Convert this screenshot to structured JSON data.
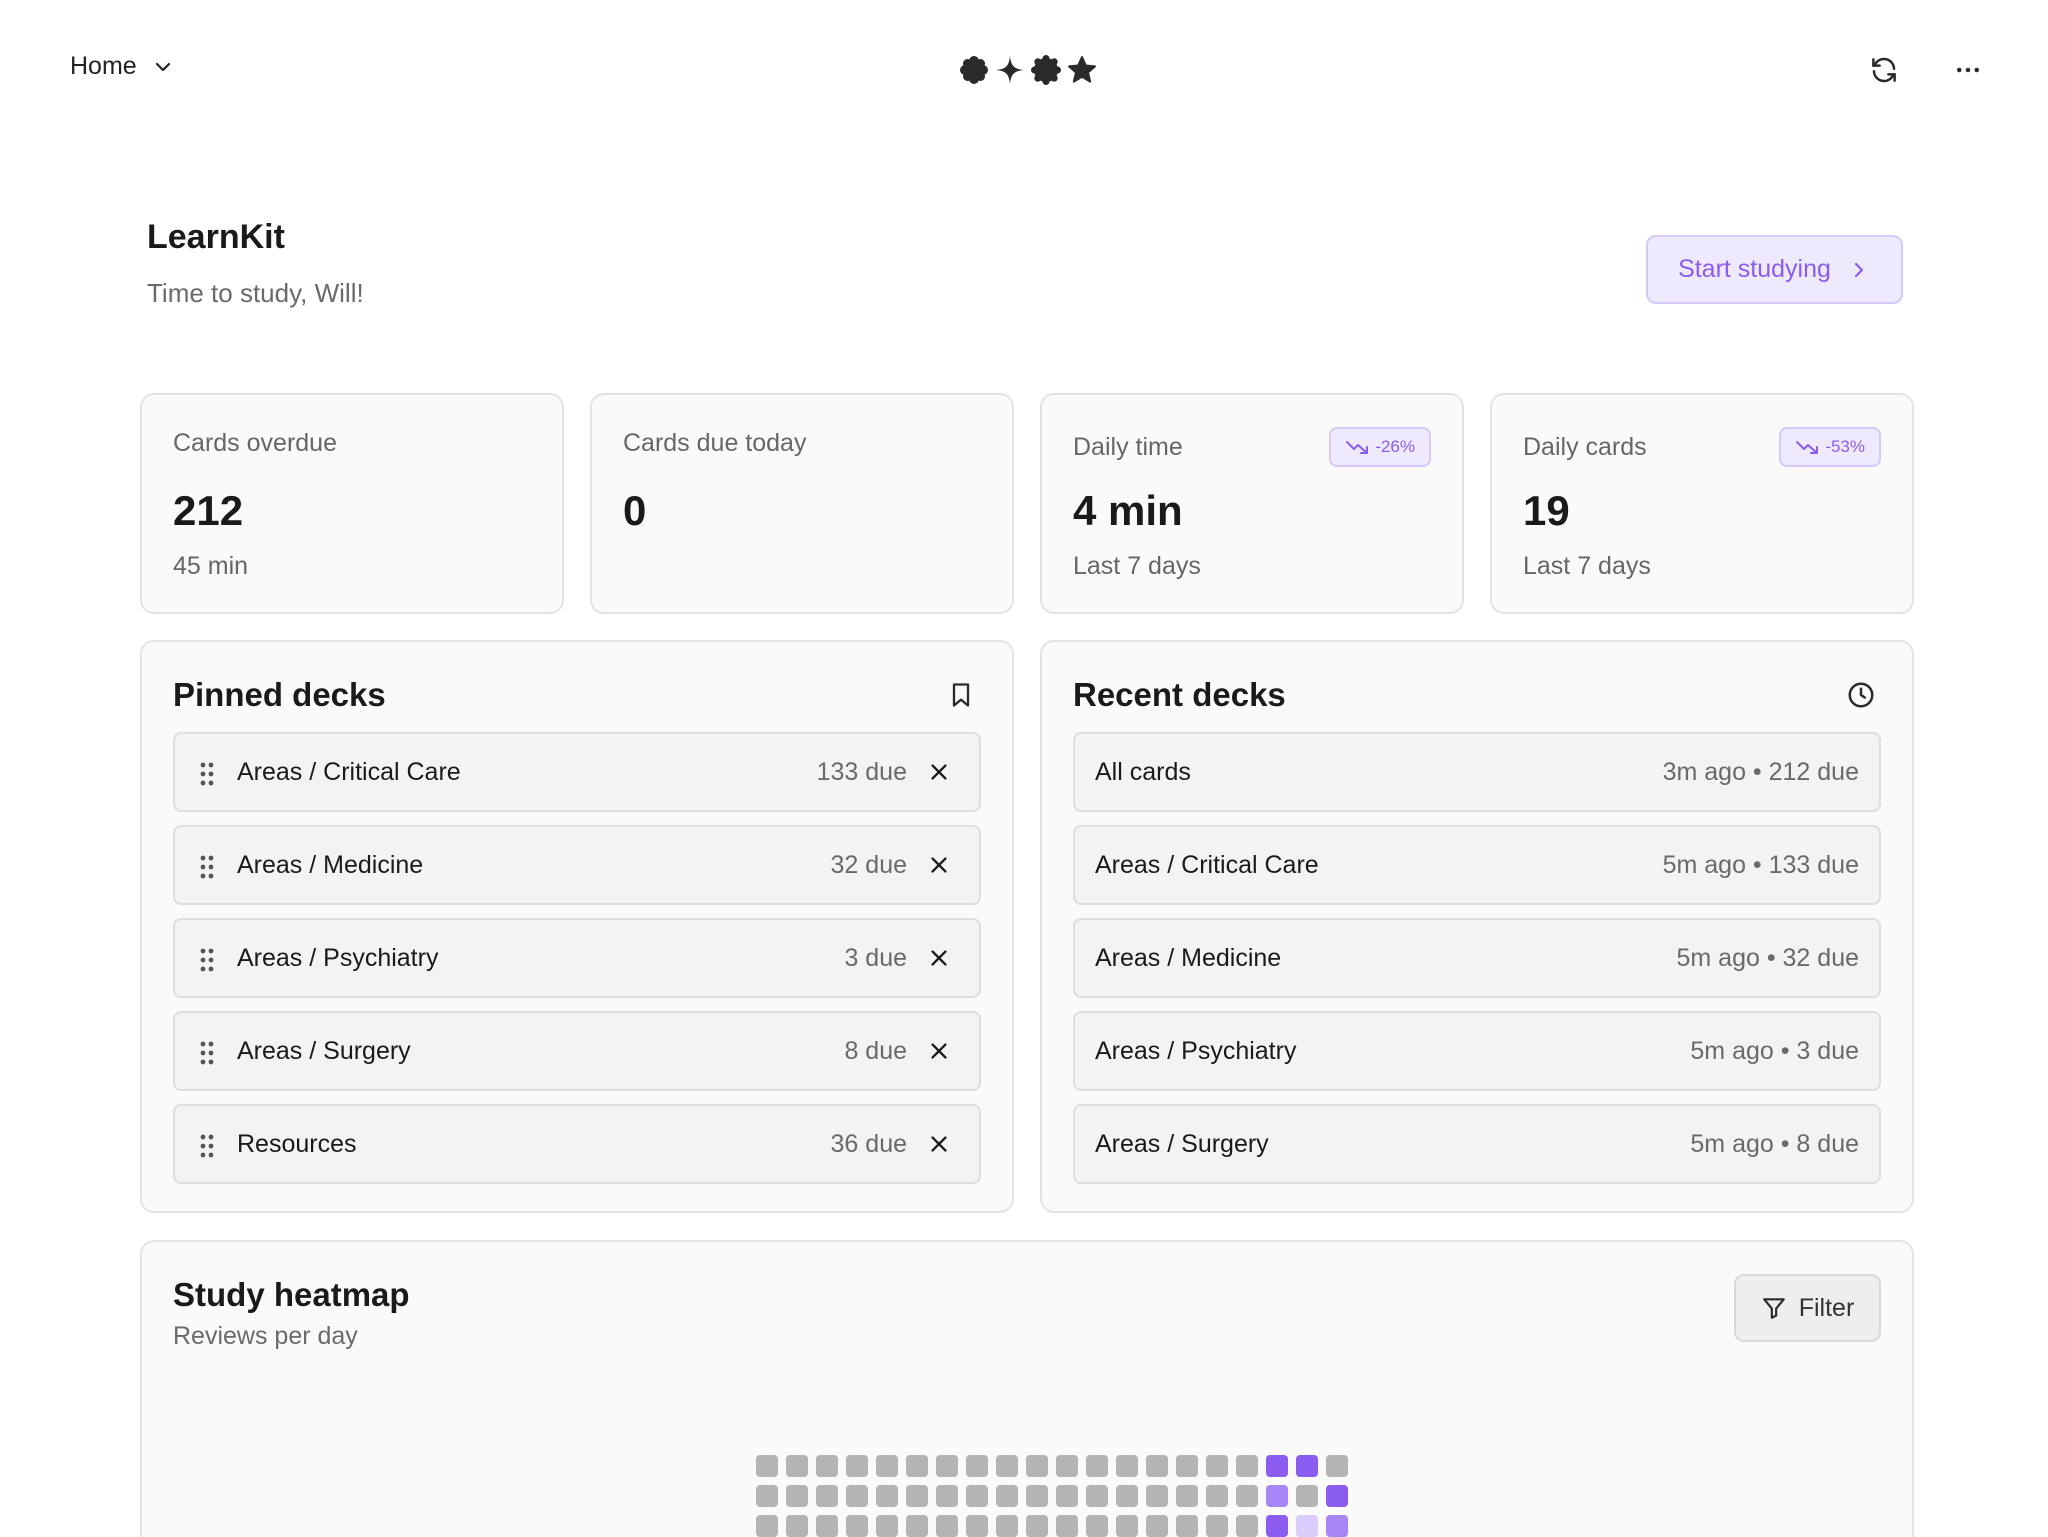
{
  "topbar": {
    "home_label": "Home"
  },
  "header": {
    "title": "LearnKit",
    "subtitle": "Time to study, Will!",
    "start_label": "Start studying"
  },
  "stats": [
    {
      "label": "Cards overdue",
      "value": "212",
      "sub": "45 min"
    },
    {
      "label": "Cards due today",
      "value": "0",
      "sub": ""
    },
    {
      "label": "Daily time",
      "value": "4 min",
      "sub": "Last 7 days",
      "trend": "-26%"
    },
    {
      "label": "Daily cards",
      "value": "19",
      "sub": "Last 7 days",
      "trend": "-53%"
    }
  ],
  "pinned": {
    "title": "Pinned decks",
    "items": [
      {
        "name": "Areas / Critical Care",
        "due": "133 due"
      },
      {
        "name": "Areas / Medicine",
        "due": "32 due"
      },
      {
        "name": "Areas / Psychiatry",
        "due": "3 due"
      },
      {
        "name": "Areas / Surgery",
        "due": "8 due"
      },
      {
        "name": "Resources",
        "due": "36 due"
      }
    ]
  },
  "recent": {
    "title": "Recent decks",
    "items": [
      {
        "name": "All cards",
        "meta": "3m ago • 212 due"
      },
      {
        "name": "Areas / Critical Care",
        "meta": "5m ago • 133 due"
      },
      {
        "name": "Areas / Medicine",
        "meta": "5m ago • 32 due"
      },
      {
        "name": "Areas / Psychiatry",
        "meta": "5m ago • 3 due"
      },
      {
        "name": "Areas / Surgery",
        "meta": "5m ago • 8 due"
      }
    ]
  },
  "heatmap": {
    "title": "Study heatmap",
    "subtitle": "Reviews per day",
    "filter_label": "Filter",
    "colors": {
      "empty": "#b4b4b4",
      "high": "#8b5cf0",
      "mid": "#a685f5",
      "low": "#d9cdfb"
    },
    "rows": [
      [
        0,
        0,
        0,
        0,
        0,
        0,
        0,
        0,
        0,
        0,
        0,
        0,
        0,
        0,
        0,
        0,
        0,
        3,
        3,
        0
      ],
      [
        0,
        0,
        0,
        0,
        0,
        0,
        0,
        0,
        0,
        0,
        0,
        0,
        0,
        0,
        0,
        0,
        0,
        2,
        0,
        3
      ],
      [
        0,
        0,
        0,
        0,
        0,
        0,
        0,
        0,
        0,
        0,
        0,
        0,
        0,
        0,
        0,
        0,
        0,
        3,
        1,
        2
      ]
    ]
  },
  "colors": {
    "accent": "#8a5cf0",
    "accent_bg": "#efe9fd"
  }
}
